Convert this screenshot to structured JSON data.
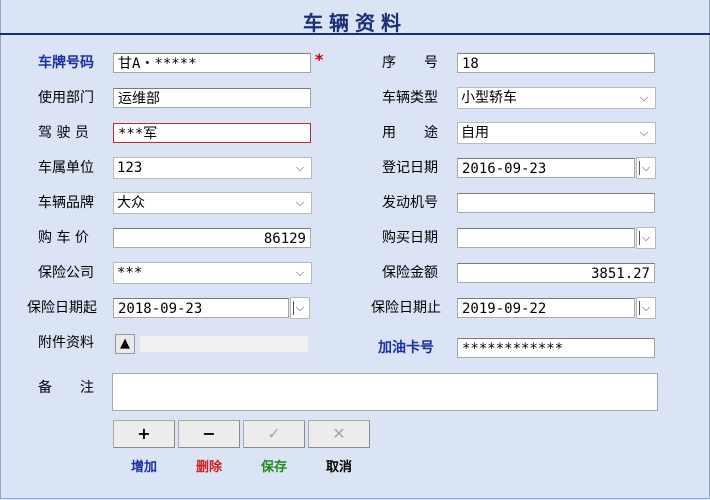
{
  "title": "车辆资料",
  "colors": {
    "title": "#1b2f78",
    "blue_label": "#1a2fa0",
    "required": "#d40000",
    "add": "#1a2fa0",
    "delete": "#d02020",
    "save": "#1f8a1f",
    "cancel": "#000000"
  },
  "required_mark": "*",
  "fields": {
    "plate": {
      "label": "车牌号码",
      "value": "甘A・*****"
    },
    "seq": {
      "label": "序　　号",
      "value": "18"
    },
    "dept": {
      "label": "使用部门",
      "value": "运维部"
    },
    "vehicle_type": {
      "label": "车辆类型",
      "value": "小型轿车"
    },
    "driver": {
      "label": "驾 驶 员",
      "value": "***军"
    },
    "usage": {
      "label": "用　　途",
      "value": "自用"
    },
    "owner_unit": {
      "label": "车属单位",
      "value": "123"
    },
    "reg_date": {
      "label": "登记日期",
      "value": "2016-09-23"
    },
    "brand": {
      "label": "车辆品牌",
      "value": "大众"
    },
    "engine_no": {
      "label": "发动机号",
      "value": ""
    },
    "price": {
      "label": "购 车 价",
      "value": "86129"
    },
    "buy_date": {
      "label": "购买日期",
      "value": ""
    },
    "insurer": {
      "label": "保险公司",
      "value": "***"
    },
    "insured_amount": {
      "label": "保险金额",
      "value": "3851.27"
    },
    "ins_start": {
      "label": "保险日期起",
      "value": "2018-09-23"
    },
    "ins_end": {
      "label": "保险日期止",
      "value": "2019-09-22"
    },
    "attachments": {
      "label": "附件资料",
      "button": "▲"
    },
    "fuel_card": {
      "label": "加油卡号",
      "value": "************"
    },
    "remarks": {
      "label": "备　　注",
      "value": ""
    }
  },
  "toolbar": {
    "add": {
      "icon": "+",
      "label": "增加"
    },
    "delete": {
      "icon": "−",
      "label": "删除"
    },
    "save": {
      "icon": "✓",
      "label": "保存"
    },
    "cancel": {
      "icon": "✕",
      "label": "取消"
    }
  }
}
